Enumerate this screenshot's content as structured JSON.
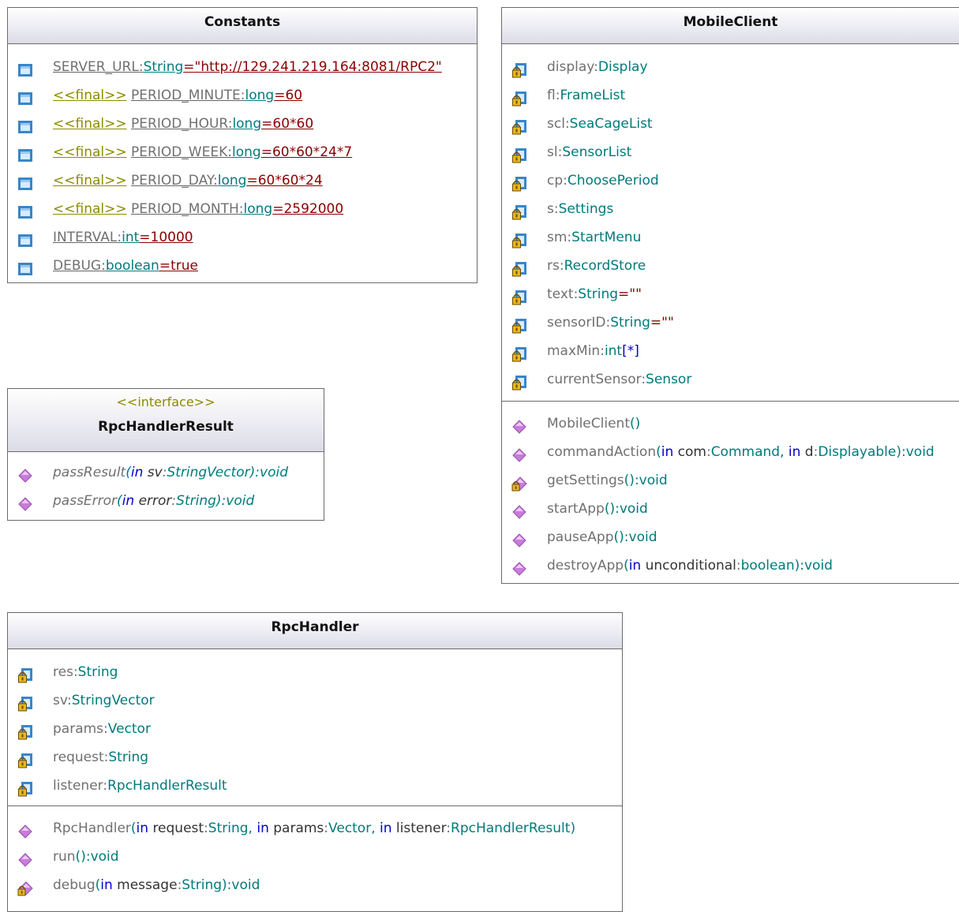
{
  "colors": {
    "name": "#707070",
    "type": "#007b7b",
    "keyword": "#0000cc",
    "value": "#8b0000",
    "stereotype": "#8b8b00",
    "operation_icon": "#c77dd9",
    "header_gradient_end": "#dcdce8"
  },
  "constants": {
    "title": "Constants",
    "fields": [
      {
        "icon": "public-static-field-icon",
        "stereotype": "",
        "name": "SERVER_URL",
        "sep": ":",
        "type": "String",
        "eq": "=",
        "value": "\"http://129.241.219.164:8081/RPC2\""
      },
      {
        "icon": "public-static-field-icon",
        "stereotype": "<<final>>",
        "name": "PERIOD_MINUTE",
        "sep": ":",
        "type": "long",
        "eq": "=",
        "value": "60"
      },
      {
        "icon": "public-static-field-icon",
        "stereotype": "<<final>>",
        "name": "PERIOD_HOUR",
        "sep": ":",
        "type": "long",
        "eq": "=",
        "value": "60*60"
      },
      {
        "icon": "public-static-field-icon",
        "stereotype": "<<final>>",
        "name": "PERIOD_WEEK",
        "sep": ":",
        "type": "long",
        "eq": "=",
        "value": "60*60*24*7"
      },
      {
        "icon": "public-static-field-icon",
        "stereotype": "<<final>>",
        "name": "PERIOD_DAY",
        "sep": ":",
        "type": "long",
        "eq": "=",
        "value": "60*60*24"
      },
      {
        "icon": "public-static-field-icon",
        "stereotype": "<<final>>",
        "name": "PERIOD_MONTH",
        "sep": ":",
        "type": "long",
        "eq": "=",
        "value": "2592000"
      },
      {
        "icon": "public-static-field-icon",
        "stereotype": "",
        "name": "INTERVAL",
        "sep": ":",
        "type": "int",
        "eq": "=",
        "value": "10000"
      },
      {
        "icon": "public-static-field-icon",
        "stereotype": "",
        "name": "DEBUG",
        "sep": ":",
        "type": "boolean",
        "eq": "=",
        "value": "true"
      }
    ]
  },
  "mobile_client": {
    "title": "MobileClient",
    "fields": [
      {
        "icon": "private-field-icon",
        "name": "display",
        "sep": ":",
        "type": "Display",
        "eq": "",
        "value": ""
      },
      {
        "icon": "private-field-icon",
        "name": "fl",
        "sep": ":",
        "type": "FrameList",
        "eq": "",
        "value": ""
      },
      {
        "icon": "private-field-icon",
        "name": "scl",
        "sep": ":",
        "type": "SeaCageList",
        "eq": "",
        "value": ""
      },
      {
        "icon": "private-field-icon",
        "name": "sl",
        "sep": ":",
        "type": "SensorList",
        "eq": "",
        "value": ""
      },
      {
        "icon": "private-field-icon",
        "name": "cp",
        "sep": ":",
        "type": "ChoosePeriod",
        "eq": "",
        "value": ""
      },
      {
        "icon": "private-field-icon",
        "name": "s",
        "sep": ":",
        "type": "Settings",
        "eq": "",
        "value": ""
      },
      {
        "icon": "private-field-icon",
        "name": "sm",
        "sep": ":",
        "type": "StartMenu",
        "eq": "",
        "value": ""
      },
      {
        "icon": "private-field-icon",
        "name": "rs",
        "sep": ":",
        "type": "RecordStore",
        "eq": "",
        "value": ""
      },
      {
        "icon": "private-field-icon",
        "name": "text",
        "sep": ":",
        "type": "String",
        "eq": "=",
        "value": "\"\""
      },
      {
        "icon": "private-field-icon",
        "name": "sensorID",
        "sep": ":",
        "type": "String",
        "eq": "=",
        "value": "\"\""
      },
      {
        "icon": "private-field-icon",
        "name": "maxMin",
        "sep": ":",
        "type": "int",
        "eq": "",
        "value": "[*]"
      },
      {
        "icon": "private-field-icon",
        "name": "currentSensor",
        "sep": ":",
        "type": "Sensor",
        "eq": "",
        "value": ""
      }
    ],
    "operations": [
      {
        "icon": "public-operation-icon",
        "name": "MobileClient",
        "params": [],
        "ret": ""
      },
      {
        "icon": "public-operation-icon",
        "name": "commandAction",
        "params": [
          {
            "kw": "in",
            "name": "com",
            "type": "Command"
          },
          {
            "kw": "in",
            "name": "d",
            "type": "Displayable"
          }
        ],
        "ret": "void"
      },
      {
        "icon": "private-operation-icon",
        "name": "getSettings",
        "params": [],
        "ret": "void"
      },
      {
        "icon": "public-operation-icon",
        "name": "startApp",
        "params": [],
        "ret": "void"
      },
      {
        "icon": "public-operation-icon",
        "name": "pauseApp",
        "params": [],
        "ret": "void"
      },
      {
        "icon": "public-operation-icon",
        "name": "destroyApp",
        "params": [
          {
            "kw": "in",
            "name": "unconditional",
            "type": "boolean"
          }
        ],
        "ret": "void"
      }
    ]
  },
  "rpc_handler_result": {
    "stereotype": "<<interface>>",
    "title": "RpcHandlerResult",
    "operations": [
      {
        "icon": "public-operation-icon",
        "name": "passResult",
        "params": [
          {
            "kw": "in",
            "name": "sv",
            "type": "StringVector"
          }
        ],
        "ret": "void"
      },
      {
        "icon": "public-operation-icon",
        "name": "passError",
        "params": [
          {
            "kw": "in",
            "name": "error",
            "type": "String"
          }
        ],
        "ret": "void"
      }
    ]
  },
  "rpc_handler": {
    "title": "RpcHandler",
    "fields": [
      {
        "icon": "private-field-icon",
        "name": "res",
        "sep": ":",
        "type": "String",
        "eq": "",
        "value": ""
      },
      {
        "icon": "private-field-icon",
        "name": "sv",
        "sep": ":",
        "type": "StringVector",
        "eq": "",
        "value": ""
      },
      {
        "icon": "private-field-icon",
        "name": "params",
        "sep": ":",
        "type": "Vector",
        "eq": "",
        "value": ""
      },
      {
        "icon": "private-field-icon",
        "name": "request",
        "sep": ":",
        "type": "String",
        "eq": "",
        "value": ""
      },
      {
        "icon": "private-field-icon",
        "name": "listener",
        "sep": ":",
        "type": "RpcHandlerResult",
        "eq": "",
        "value": ""
      }
    ],
    "operations": [
      {
        "icon": "public-operation-icon",
        "name": "RpcHandler",
        "params": [
          {
            "kw": "in",
            "name": "request",
            "type": "String"
          },
          {
            "kw": "in",
            "name": "params",
            "type": "Vector"
          },
          {
            "kw": "in",
            "name": "listener",
            "type": "RpcHandlerResult"
          }
        ],
        "ret": ""
      },
      {
        "icon": "public-operation-icon",
        "name": "run",
        "params": [],
        "ret": "void"
      },
      {
        "icon": "private-operation-icon",
        "name": "debug",
        "params": [
          {
            "kw": "in",
            "name": "message",
            "type": "String"
          }
        ],
        "ret": "void"
      }
    ]
  }
}
